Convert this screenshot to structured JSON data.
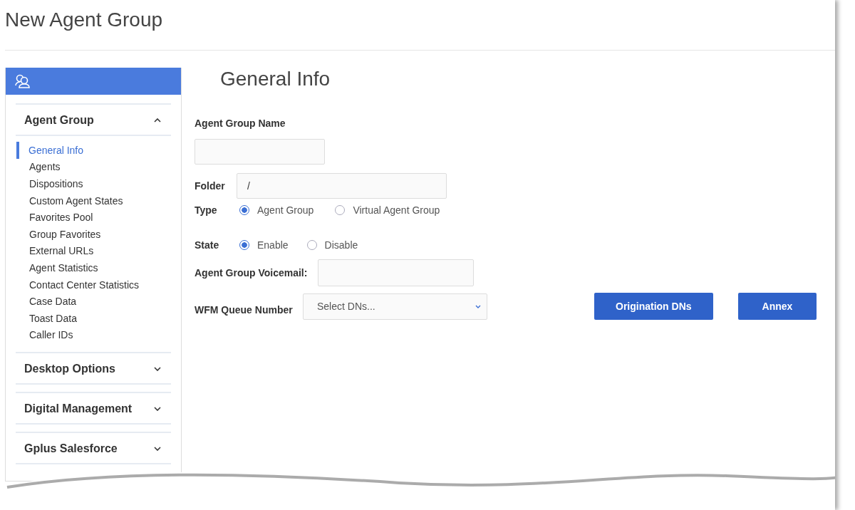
{
  "page_title": "New Agent Group",
  "sidebar": {
    "sections": [
      {
        "label": "Agent Group",
        "expanded": true,
        "items": [
          {
            "label": "General Info",
            "selected": true
          },
          {
            "label": "Agents",
            "selected": false
          },
          {
            "label": "Dispositions",
            "selected": false
          },
          {
            "label": "Custom Agent States",
            "selected": false
          },
          {
            "label": "Favorites Pool",
            "selected": false
          },
          {
            "label": "Group Favorites",
            "selected": false
          },
          {
            "label": "External URLs",
            "selected": false
          },
          {
            "label": "Agent Statistics",
            "selected": false
          },
          {
            "label": "Contact Center Statistics",
            "selected": false
          },
          {
            "label": "Case Data",
            "selected": false
          },
          {
            "label": "Toast Data",
            "selected": false
          },
          {
            "label": "Caller IDs",
            "selected": false
          }
        ]
      },
      {
        "label": "Desktop Options",
        "expanded": false
      },
      {
        "label": "Digital Management",
        "expanded": false
      },
      {
        "label": "Gplus Salesforce",
        "expanded": false
      }
    ]
  },
  "form": {
    "heading": "General Info",
    "name_label": "Agent Group Name",
    "folder": {
      "label": "Folder",
      "value": "/"
    },
    "type": {
      "label": "Type",
      "options": [
        {
          "label": "Agent Group",
          "selected": true
        },
        {
          "label": "Virtual Agent Group",
          "selected": false
        }
      ]
    },
    "state": {
      "label": "State",
      "options": [
        {
          "label": "Enable",
          "selected": true
        },
        {
          "label": "Disable",
          "selected": false
        }
      ]
    },
    "voicemail_label": "Agent Group Voicemail:",
    "wfm": {
      "label": "WFM Queue Number",
      "placeholder": "Select DNs..."
    },
    "buttons": [
      "Origination DNs",
      "Annex"
    ]
  }
}
